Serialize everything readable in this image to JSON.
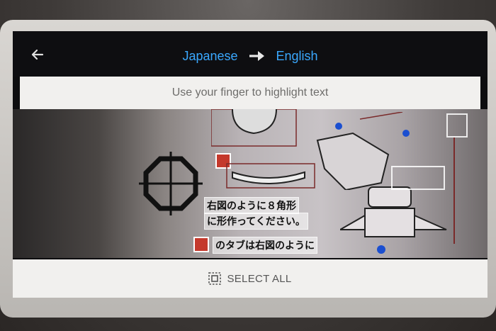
{
  "header": {
    "source_language": "Japanese",
    "target_language": "English",
    "back_icon": "arrow-left-icon",
    "swap_icon": "arrow-right-icon",
    "accent_color": "#3aa8ff"
  },
  "hint": {
    "text": "Use your finger to highlight text"
  },
  "camera_view": {
    "detected_lines": [
      "右図のように８角形",
      "に形作ってください。",
      "のタブは右図のように"
    ]
  },
  "bottom": {
    "select_all_label": "SELECT ALL",
    "select_all_icon": "select-all-icon"
  }
}
